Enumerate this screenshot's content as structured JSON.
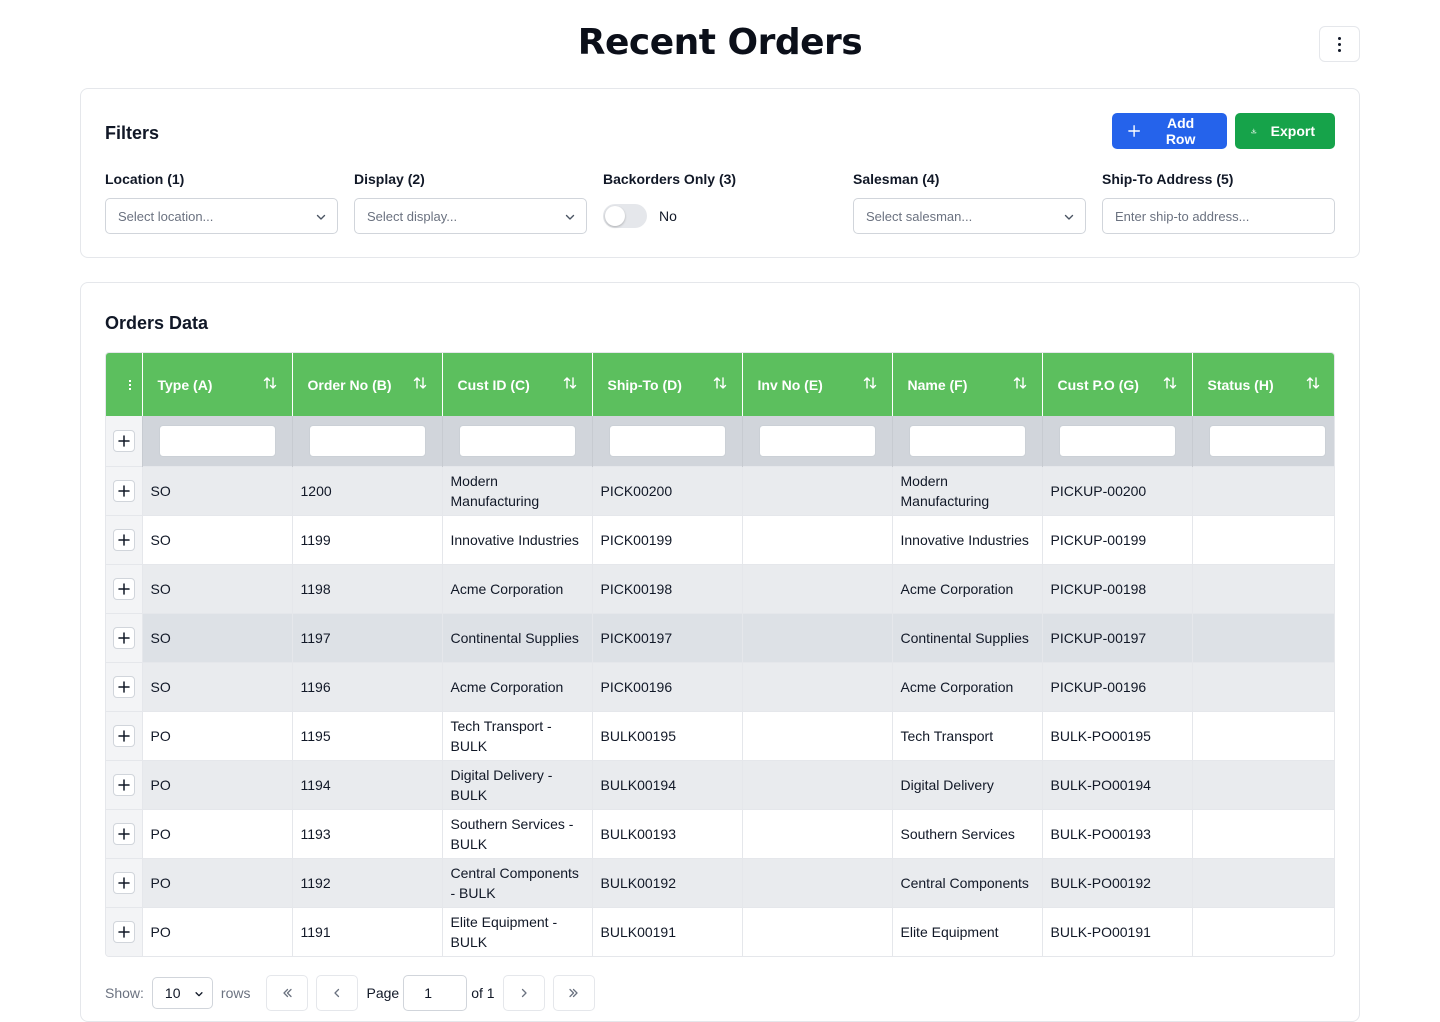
{
  "page": {
    "title": "Recent Orders"
  },
  "filters": {
    "title": "Filters",
    "add_row_label": "Add Row",
    "export_label": "Export",
    "location": {
      "label": "Location (1)",
      "placeholder": "Select location..."
    },
    "display": {
      "label": "Display (2)",
      "placeholder": "Select display..."
    },
    "backorders": {
      "label": "Backorders Only (3)",
      "value": "No",
      "checked": false
    },
    "salesman": {
      "label": "Salesman (4)",
      "placeholder": "Select salesman..."
    },
    "ship_to": {
      "label": "Ship-To Address (5)",
      "placeholder": "Enter ship-to address..."
    }
  },
  "orders": {
    "title": "Orders Data",
    "columns": [
      "Type (A)",
      "Order No (B)",
      "Cust ID (C)",
      "Ship-To (D)",
      "Inv No (E)",
      "Name (F)",
      "Cust P.O (G)",
      "Status (H)"
    ],
    "rows": [
      [
        "SO",
        "1200",
        "Modern Manufacturing",
        "PICK00200",
        "",
        "Modern Manufacturing",
        "PICKUP-00200",
        ""
      ],
      [
        "SO",
        "1199",
        "Innovative Industries",
        "PICK00199",
        "",
        "Innovative Industries",
        "PICKUP-00199",
        ""
      ],
      [
        "SO",
        "1198",
        "Acme Corporation",
        "PICK00198",
        "",
        "Acme Corporation",
        "PICKUP-00198",
        ""
      ],
      [
        "SO",
        "1197",
        "Continental Supplies",
        "PICK00197",
        "",
        "Continental Supplies",
        "PICKUP-00197",
        ""
      ],
      [
        "SO",
        "1196",
        "Acme Corporation",
        "PICK00196",
        "",
        "Acme Corporation",
        "PICKUP-00196",
        ""
      ],
      [
        "PO",
        "1195",
        "Tech Transport - BULK",
        "BULK00195",
        "",
        "Tech Transport",
        "BULK-PO00195",
        ""
      ],
      [
        "PO",
        "1194",
        "Digital Delivery - BULK",
        "BULK00194",
        "",
        "Digital Delivery",
        "BULK-PO00194",
        ""
      ],
      [
        "PO",
        "1193",
        "Southern Services - BULK",
        "BULK00193",
        "",
        "Southern Services",
        "BULK-PO00193",
        ""
      ],
      [
        "PO",
        "1192",
        "Central Components - BULK",
        "BULK00192",
        "",
        "Central Components",
        "BULK-PO00192",
        ""
      ],
      [
        "PO",
        "1191",
        "Elite Equipment - BULK",
        "BULK00191",
        "",
        "Elite Equipment",
        "BULK-PO00191",
        ""
      ]
    ]
  },
  "pagination": {
    "show_label": "Show:",
    "rows_value": "10",
    "rows_label": "rows",
    "page_label": "Page",
    "page_value": "1",
    "of_label": "of 1"
  },
  "colors": {
    "header_green": "#5cbf5e",
    "add_row_blue": "#2563eb",
    "export_green": "#16a34a"
  },
  "icons": {
    "page_menu": "kebab-icon",
    "add_row": "plus-icon",
    "export": "download-icon",
    "dropdown": "chevron-down-icon",
    "sort": "sort-icon",
    "row_expand": "plus-icon",
    "first_page": "chevrons-left-icon",
    "prev_page": "chevron-left-icon",
    "next_page": "chevron-right-icon",
    "last_page": "chevrons-right-icon"
  }
}
